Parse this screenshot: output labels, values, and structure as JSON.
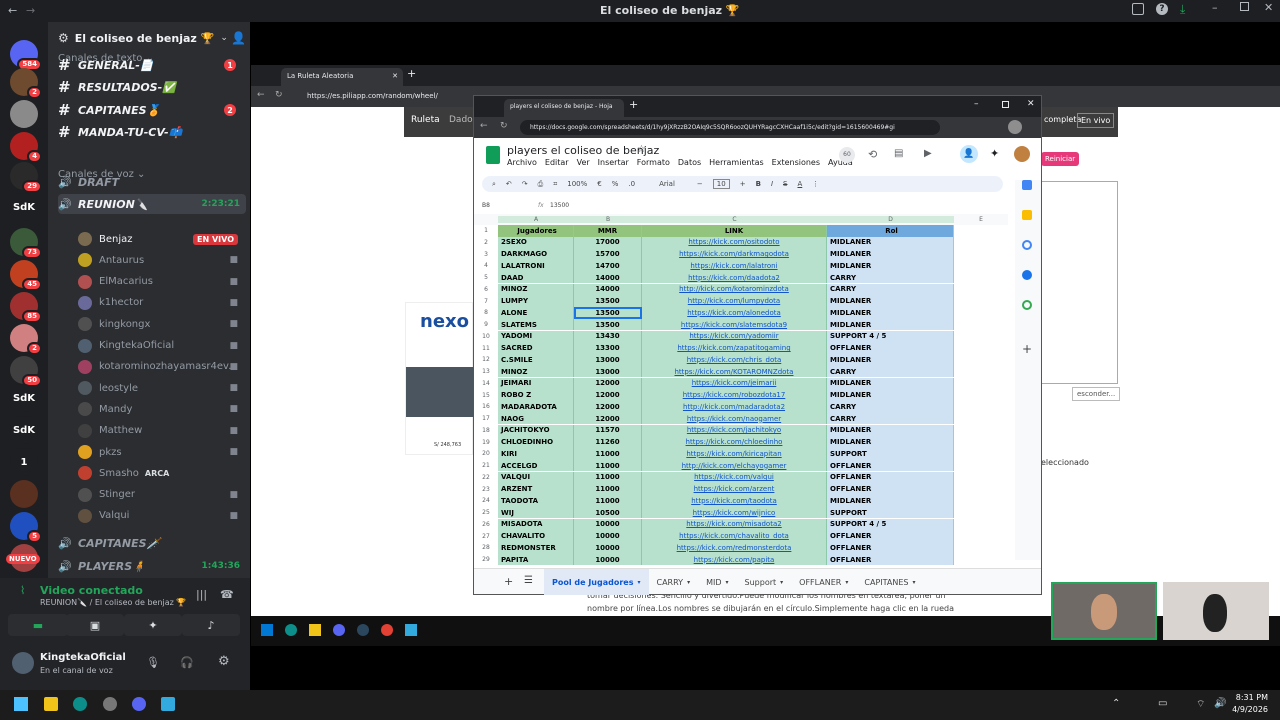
{
  "window": {
    "title": "El coliseo de benjaz 🏆"
  },
  "server": {
    "name": "El coliseo de benjaz 🏆"
  },
  "servers": [
    {
      "label": "",
      "badge": "584",
      "color": "#5865f2"
    },
    {
      "label": "",
      "badge": "2",
      "color": "#6e4a2e"
    },
    {
      "label": "",
      "badge": "",
      "color": "#8a8a8a"
    },
    {
      "label": "",
      "badge": "4",
      "color": "#b32020"
    },
    {
      "label": "",
      "badge": "29",
      "color": "#2a2a2a"
    },
    {
      "label": "SdK",
      "badge": "",
      "color": "#1e1f22"
    },
    {
      "label": "",
      "badge": "73",
      "color": "#3a5a3a"
    },
    {
      "label": "",
      "badge": "45",
      "color": "#c04020"
    },
    {
      "label": "",
      "badge": "85",
      "color": "#a03030"
    },
    {
      "label": "",
      "badge": "2",
      "color": "#d08080"
    },
    {
      "label": "",
      "badge": "50",
      "color": "#404040"
    },
    {
      "label": "SdK",
      "badge": "",
      "color": "#1e1f22"
    },
    {
      "label": "SdK",
      "badge": "",
      "color": "#1e1f22"
    },
    {
      "label": "1",
      "badge": "",
      "color": "#1e1f22"
    },
    {
      "label": "",
      "badge": "",
      "color": "#5a3020"
    },
    {
      "label": "",
      "badge": "5",
      "color": "#2050c0"
    },
    {
      "label": "",
      "badge": "",
      "color": "#a04040"
    }
  ],
  "servers_new": "NUEVO",
  "text_category": "Canales de texto",
  "text_channels": [
    {
      "name": "GENERAL-📄",
      "badge": "1"
    },
    {
      "name": "RESULTADOS-✅",
      "badge": ""
    },
    {
      "name": "CAPITANES🏅",
      "badge": "2"
    },
    {
      "name": "MANDA-TU-CV-📫",
      "badge": ""
    }
  ],
  "voice_category": "Canales de voz",
  "voice_channels": [
    {
      "name": "DRAFT",
      "time": ""
    },
    {
      "name": "REUNION🔪",
      "time": "2:23:21"
    }
  ],
  "voice_users": [
    {
      "name": "Benjaz",
      "extra": "EN VIVO",
      "color": "#7a6a50"
    },
    {
      "name": "Antaurus",
      "extra": "",
      "color": "#c0a020"
    },
    {
      "name": "ElMacarius",
      "extra": "",
      "color": "#b05050"
    },
    {
      "name": "k1hector",
      "extra": "",
      "color": "#6a6a9a"
    },
    {
      "name": "kingkongx",
      "extra": "",
      "color": "#505050"
    },
    {
      "name": "KingtekaOficial",
      "extra": "",
      "color": "#506070"
    },
    {
      "name": "kotarominozhayamasr4ev...",
      "extra": "",
      "color": "#a04060"
    },
    {
      "name": "leostyle",
      "extra": "",
      "color": "#505860"
    },
    {
      "name": "Mandy",
      "extra": "",
      "color": "#4a4a4a"
    },
    {
      "name": "Matthew",
      "extra": "",
      "color": "#404040"
    },
    {
      "name": "pkzs",
      "extra": "",
      "color": "#e0a020"
    },
    {
      "name": "Smasho",
      "extra": "ARCA",
      "color": "#c04030"
    },
    {
      "name": "Stinger",
      "extra": "",
      "color": "#505050"
    },
    {
      "name": "Valqui",
      "extra": "",
      "color": "#605040"
    }
  ],
  "bottom_channels": [
    {
      "name": "CAPITANES🗡️",
      "time": ""
    },
    {
      "name": "PLAYERS🧍",
      "time": "1:43:36"
    }
  ],
  "voice_panel": {
    "status": "Video conectado",
    "channel": "REUNION🔪 / El coliseo de benjaz 🏆"
  },
  "user": {
    "name": "KingtekaOficial",
    "status": "En el canal de voz"
  },
  "browser1": {
    "tab": "La Ruleta Aleatoria",
    "url": "https://es.piliapp.com/random/wheel/",
    "btn1": "Ruleta",
    "btn2": "Dado",
    "btn3": "En vivo",
    "btn4": "Reiniciar",
    "btn5": "esconder...",
    "btn6": "completa",
    "selected": "eleccionado",
    "price": "S/ 248,763",
    "bottom_text1": "tomar decisiones. Sencillo y divertido.Puede modificar los nombres en textarea, poner un",
    "bottom_text2": "nombre por línea.Los nombres se dibujarán en el círculo.Simplemente haga clic en la rueda"
  },
  "sheets": {
    "tab": "players el coliseo de benjaz - Hoja",
    "url": "https://docs.google.com/spreadsheets/d/1hy9jXRzzB2OAIq9c5SQR6oozQUHYRagcCXHCaaf1i5c/edit?gid=1615600469#gi",
    "title": "players el coliseo de benjaz",
    "menu": [
      "Archivo",
      "Editar",
      "Ver",
      "Insertar",
      "Formato",
      "Datos",
      "Herramientas",
      "Extensiones",
      "Ayuda"
    ],
    "zoom": "100%",
    "font": "Arial",
    "size": "10",
    "cellref": "B8",
    "formula": "13500",
    "col_letters": [
      "A",
      "B",
      "C",
      "D",
      "E"
    ],
    "headers": [
      "Jugadores",
      "MMR",
      "LINK",
      "Rol"
    ],
    "rows": [
      [
        "2SEXO",
        "17000",
        "https://kick.com/ositodoto",
        "MIDLANER"
      ],
      [
        "DARKMAGO",
        "15700",
        "https://kick.com/darkmagodota",
        "MIDLANER"
      ],
      [
        "LALATRONI",
        "14700",
        "https://kick.com/lalatroni",
        "MIDLANER"
      ],
      [
        "DAAD",
        "14000",
        "https://kick.com/daadota2",
        "CARRY"
      ],
      [
        "MINOZ",
        "14000",
        "http://kick.com/kotarominzdota",
        "CARRY"
      ],
      [
        "LUMPY",
        "13500",
        "http://kick.com/lumpydota",
        "MIDLANER"
      ],
      [
        "ALONE",
        "13500",
        "https://kick.com/alonedota",
        "MIDLANER"
      ],
      [
        "SLATEMS",
        "13500",
        "https://kick.com/slatemsdota9",
        "MIDLANER"
      ],
      [
        "YADOMI",
        "13430",
        "https://kick.com/yadomiir",
        "SUPPORT 4 / 5"
      ],
      [
        "SACRED",
        "13300",
        "https://kick.com/zapatitogaming",
        "OFFLANER"
      ],
      [
        "C.SMILE",
        "13000",
        "https://kick.com/chris_dota",
        "MIDLANER"
      ],
      [
        "MINOZ",
        "13000",
        "https://kick.com/KOTAROMNZdota",
        "CARRY"
      ],
      [
        "JEIMARI",
        "12000",
        "https://kick.com/jeimarii",
        "MIDLANER"
      ],
      [
        "ROBO Z",
        "12000",
        "https://kick.com/robozdota17",
        "MIDLANER"
      ],
      [
        "MADARADOTA",
        "12000",
        "http://kick.com/madaradota2",
        "CARRY"
      ],
      [
        "NAOG",
        "12000",
        "https://kick.com/naogamer",
        "CARRY"
      ],
      [
        "JACHITOKYO",
        "11570",
        "https://kick.com/jachitokyo",
        "MIDLANER"
      ],
      [
        "CHLOEDINHO",
        "11260",
        "https://kick.com/chloedinho",
        "MIDLANER"
      ],
      [
        "KIRI",
        "11000",
        "https://kick.com/kiricapitan",
        "SUPPORT"
      ],
      [
        "ACCELGD",
        "11000",
        "http://kick.com/elchayogamer",
        "OFFLANER"
      ],
      [
        "VALQUI",
        "11000",
        "https://kick.com/valqui",
        "OFFLANER"
      ],
      [
        "ARZENT",
        "11000",
        "https://kick.com/arzent",
        "OFFLANER"
      ],
      [
        "TAODOTA",
        "11000",
        "https://kick.com/taodota",
        "MIDLANER"
      ],
      [
        "WIJ",
        "10500",
        "https://kick.com/wijnico",
        "SUPPORT"
      ],
      [
        "MISADOTA",
        "10000",
        "https://kick.com/misadota2",
        "SUPPORT 4 / 5"
      ],
      [
        "CHAVALITO",
        "10000",
        "https://kick.com/chavalito_dota",
        "OFFLANER"
      ],
      [
        "REDMONSTER",
        "10000",
        "https://kick.com/redmonsterdota",
        "OFFLANER"
      ],
      [
        "PAPITA",
        "10000",
        "https://kick.com/papita",
        "OFFLANER"
      ]
    ],
    "sheet_tabs": [
      "Pool de Jugadores",
      "CARRY",
      "MID",
      "Support",
      "OFFLANER",
      "CAPITANES"
    ]
  },
  "taskbar": {
    "time": "8:31 PM",
    "date": "4/9/2026"
  }
}
